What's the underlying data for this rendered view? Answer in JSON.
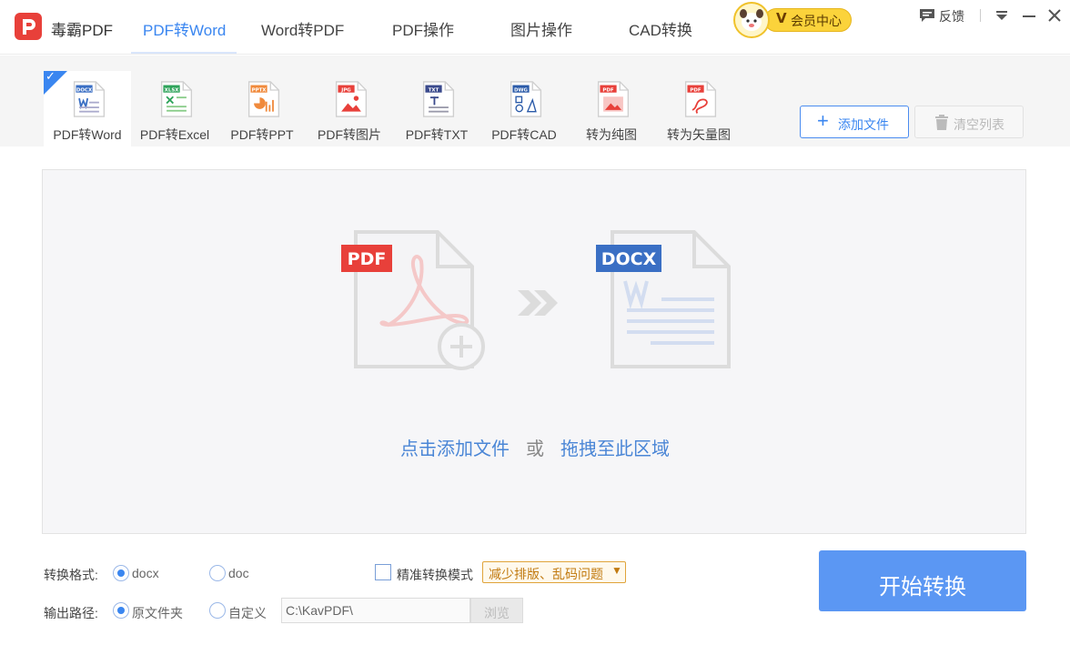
{
  "app": {
    "title": "毒霸PDF"
  },
  "nav": {
    "tabs": [
      {
        "label": "PDF转Word",
        "active": true
      },
      {
        "label": "Word转PDF",
        "active": false
      },
      {
        "label": "PDF操作",
        "active": false
      },
      {
        "label": "图片操作",
        "active": false
      },
      {
        "label": "CAD转换",
        "active": false
      }
    ]
  },
  "vip": {
    "badge": "V",
    "label": "会员中心"
  },
  "window": {
    "feedback_label": "反馈",
    "icons": [
      "feedback-icon",
      "dropdown-icon",
      "minimize-icon",
      "close-icon"
    ]
  },
  "tools": [
    {
      "label": "PDF转Word",
      "tag": "DOCX",
      "color": "#3a6fc4",
      "active": true
    },
    {
      "label": "PDF转Excel",
      "tag": "XLSX",
      "color": "#2ea35a",
      "active": false
    },
    {
      "label": "PDF转PPT",
      "tag": "PPTX",
      "color": "#f08a3c",
      "active": false
    },
    {
      "label": "PDF转图片",
      "tag": "JPG",
      "color": "#e8403a",
      "active": false
    },
    {
      "label": "PDF转TXT",
      "tag": "TXT",
      "color": "#3a4a8c",
      "active": false
    },
    {
      "label": "PDF转CAD",
      "tag": "DWG",
      "color": "#2a5aa8",
      "active": false
    },
    {
      "label": "转为纯图",
      "tag": "PDF",
      "color": "#e8403a",
      "active": false
    },
    {
      "label": "转为矢量图",
      "tag": "PDF",
      "color": "#e8403a",
      "active": false
    }
  ],
  "actions": {
    "add_file": "添加文件",
    "clear_list": "清空列表"
  },
  "dropzone": {
    "from_tag": "PDF",
    "to_tag": "DOCX",
    "click_add": "点击添加文件",
    "or": "或",
    "drag_here": "拖拽至此区域"
  },
  "options": {
    "format_label": "转换格式:",
    "format_choices": [
      {
        "label": "docx",
        "selected": true
      },
      {
        "label": "doc",
        "selected": false
      }
    ],
    "precise_mode_label": "精准转换模式",
    "precise_mode_checked": false,
    "hint": "减少排版、乱码问题",
    "output_label": "输出路径:",
    "output_choices": [
      {
        "label": "原文件夹",
        "selected": true
      },
      {
        "label": "自定义",
        "selected": false
      }
    ],
    "output_path": "C:\\KavPDF\\",
    "browse": "浏览"
  },
  "start_button": "开始转换",
  "colors": {
    "accent": "#3a86f0",
    "start_button": "#5b97f3",
    "pdf_red": "#e8403a",
    "docx_blue": "#3a6fc4",
    "hint_orange": "#c17a10"
  }
}
